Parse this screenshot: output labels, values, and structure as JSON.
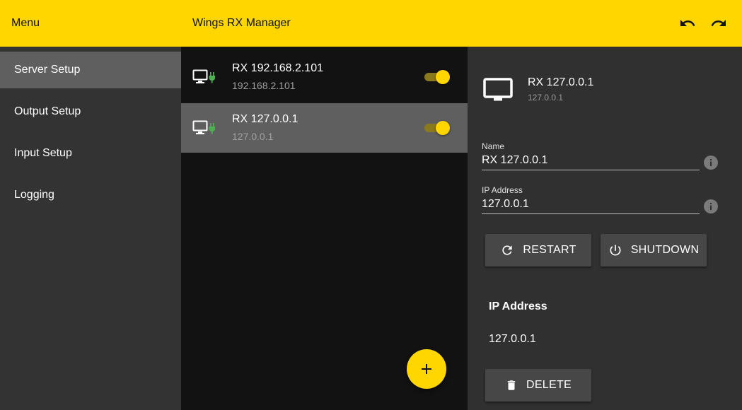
{
  "header": {
    "menu_title": "Menu",
    "app_title": "Wings RX Manager",
    "undo_icon": "undo-icon",
    "redo_icon": "redo-icon",
    "background_color": "#ffd600"
  },
  "sidebar": {
    "items": [
      {
        "label": "Server Setup",
        "active": true
      },
      {
        "label": "Output Setup",
        "active": false
      },
      {
        "label": "Input Setup",
        "active": false
      },
      {
        "label": "Logging",
        "active": false
      }
    ]
  },
  "servers": [
    {
      "title": "RX 192.168.2.101",
      "subtitle": "192.168.2.101",
      "enabled": true,
      "selected": false,
      "icon": "monitor-plug-icon"
    },
    {
      "title": "RX 127.0.0.1",
      "subtitle": "127.0.0.1",
      "enabled": true,
      "selected": true,
      "icon": "monitor-plug-icon"
    }
  ],
  "add_button": {
    "icon": "plus-icon"
  },
  "detail": {
    "title": "RX 127.0.0.1",
    "subtitle": "127.0.0.1",
    "icon": "monitor-icon",
    "name_label": "Name",
    "name_value": "RX 127.0.0.1",
    "ip_label": "IP Address",
    "ip_value": "127.0.0.1",
    "restart_label": "RESTART",
    "shutdown_label": "SHUTDOWN",
    "ip_section_title": "IP Address",
    "ip_section_value": "127.0.0.1",
    "delete_label": "DELETE"
  },
  "colors": {
    "accent": "#ffd600",
    "plug_green": "#4caf50",
    "sidebar_bg": "#333333",
    "list_bg": "#121212",
    "detail_bg": "#303030"
  }
}
